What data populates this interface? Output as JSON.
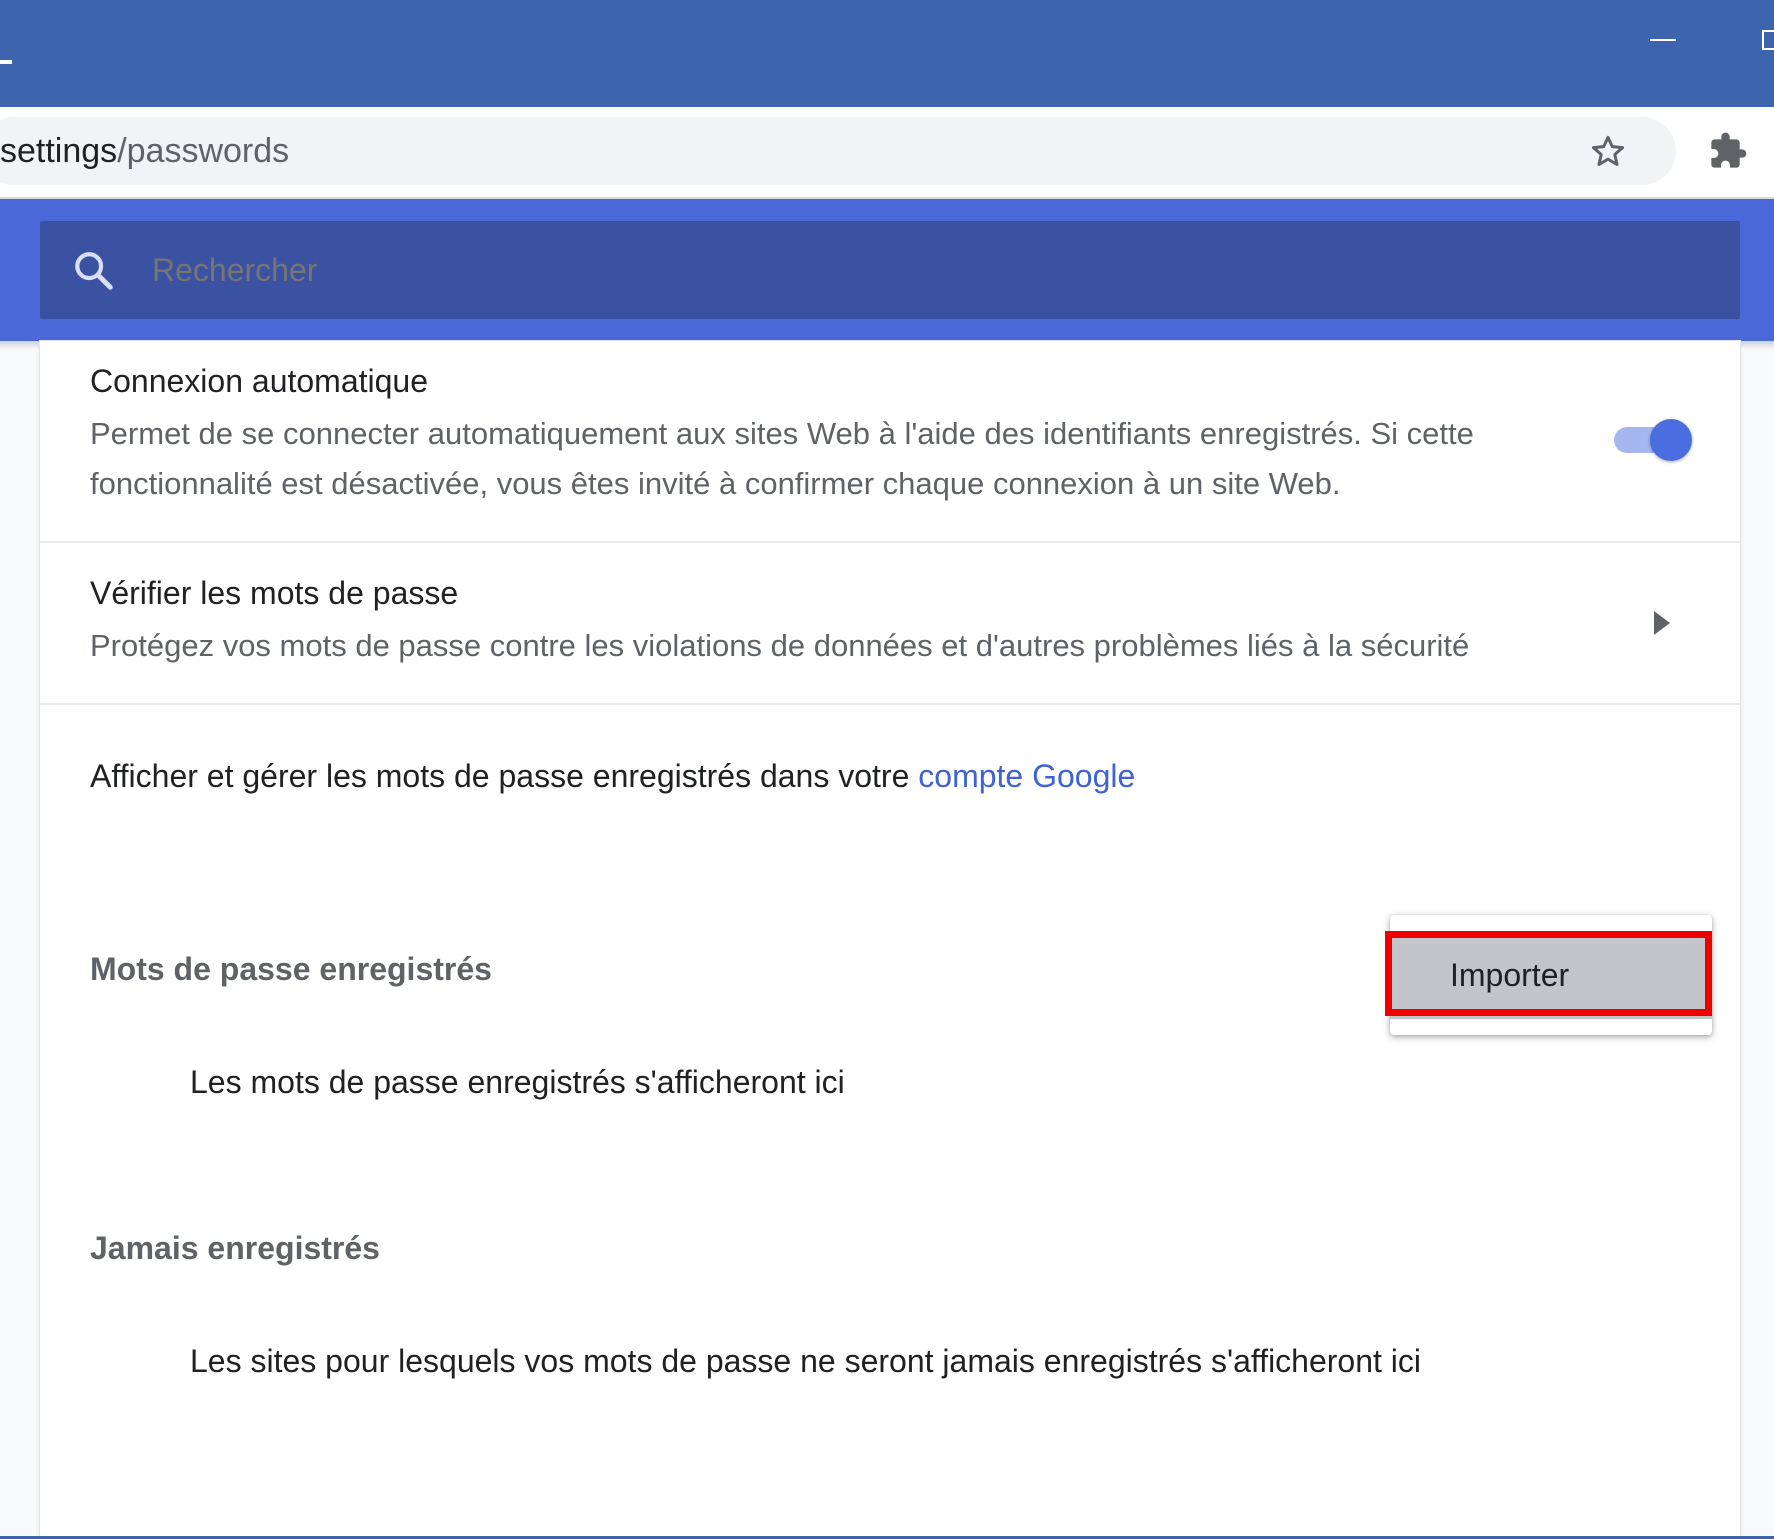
{
  "browser": {
    "url_host": "settings",
    "url_path": "/passwords",
    "icons": [
      "star-icon",
      "puzzle-icon"
    ]
  },
  "search": {
    "placeholder": "Rechercher"
  },
  "settings": {
    "auto_signin": {
      "title": "Connexion automatique",
      "description": "Permet de se connecter automatiquement aux sites Web à l'aide des identifiants enregistrés. Si cette fonctionnalité est désactivée, vous êtes invité à confirmer chaque connexion à un site Web.",
      "enabled": true
    },
    "check_passwords": {
      "title": "Vérifier les mots de passe",
      "description": "Protégez vos mots de passe contre les violations de données et d'autres problèmes liés à la sécurité"
    },
    "google_account": {
      "text": "Afficher et gérer les mots de passe enregistrés dans votre ",
      "link": "compte Google"
    },
    "saved_passwords": {
      "title": "Mots de passe enregistrés",
      "empty": "Les mots de passe enregistrés s'afficheront ici"
    },
    "never_saved": {
      "title": "Jamais enregistrés",
      "empty": "Les sites pour lesquels vos mots de passe ne seront jamais enregistrés s'afficheront ici"
    }
  },
  "menu": {
    "import_label": "Importer"
  },
  "colors": {
    "title_bar": "#3c65ad",
    "header_band": "#4a68d8",
    "search_box": "#3b52a2",
    "link": "#3f63d4",
    "highlight": "#ee0000"
  }
}
